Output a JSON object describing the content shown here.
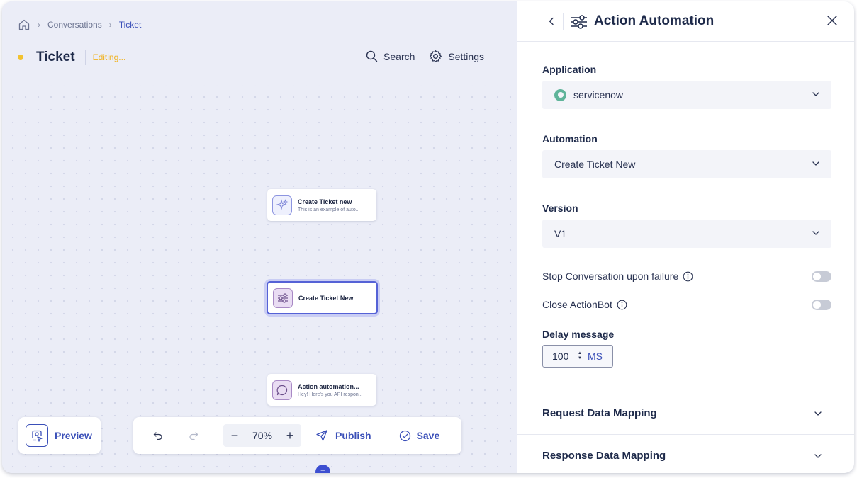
{
  "breadcrumb": {
    "home_icon": "home-icon",
    "items": [
      "Conversations",
      "Ticket"
    ]
  },
  "page": {
    "title": "Ticket",
    "status": "Editing..."
  },
  "top_actions": {
    "search": "Search",
    "settings": "Settings"
  },
  "nodes": [
    {
      "title": "Create Ticket new",
      "subtitle": "This is an example of auto...",
      "icon": "sparkle-icon"
    },
    {
      "title": "Create Ticket New",
      "subtitle": "",
      "icon": "automation-icon"
    },
    {
      "title": "Action automation...",
      "subtitle": "Hey! Here's you API respon...",
      "icon": "message-icon"
    }
  ],
  "bottom_toolbar": {
    "preview": "Preview",
    "zoom": "70%",
    "zoom_out": "−",
    "zoom_in": "+",
    "publish": "Publish",
    "save": "Save",
    "add": "+"
  },
  "panel": {
    "title": "Action Automation",
    "application": {
      "label": "Application",
      "value": "servicenow"
    },
    "automation": {
      "label": "Automation",
      "value": "Create Ticket New"
    },
    "version": {
      "label": "Version",
      "value": "V1"
    },
    "stop_on_failure": {
      "label": "Stop Conversation upon failure",
      "enabled": false
    },
    "close_actionbot": {
      "label": "Close ActionBot",
      "enabled": false
    },
    "delay": {
      "label": "Delay message",
      "value": "100",
      "unit": "MS"
    },
    "sections": [
      "Request Data Mapping",
      "Response Data Mapping"
    ]
  },
  "colors": {
    "accent": "#3a4fb8",
    "status": "#f2c230",
    "editing": "#f0b323"
  }
}
